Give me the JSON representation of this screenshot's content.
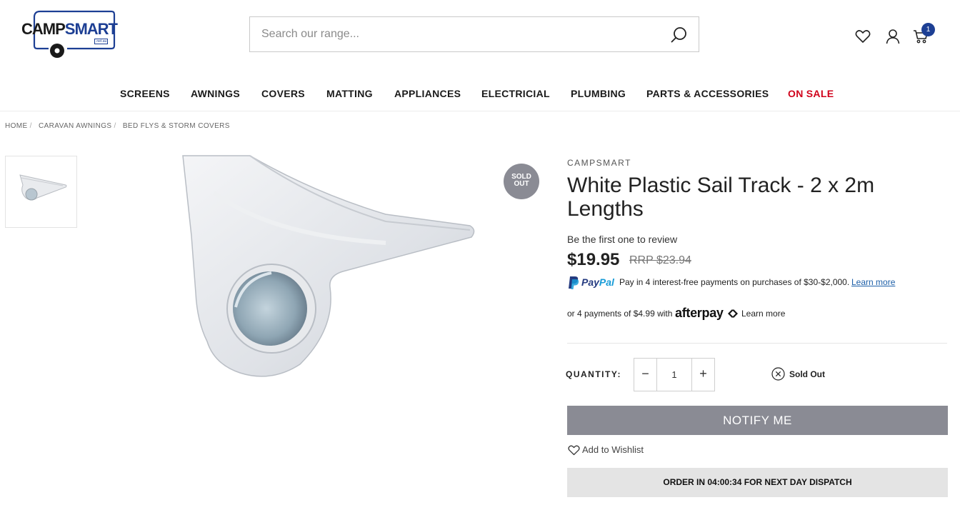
{
  "header": {
    "logo": {
      "text_camp": "CAMP",
      "text_smart": "SMART",
      "domain": ".net.au"
    },
    "search": {
      "placeholder": "Search our range...",
      "value": ""
    },
    "icons": [
      "search-icon",
      "heart-icon",
      "user-icon",
      "cart-icon"
    ],
    "cart_count": "1"
  },
  "nav": {
    "items": [
      {
        "label": "SCREENS"
      },
      {
        "label": "AWNINGS"
      },
      {
        "label": "COVERS"
      },
      {
        "label": "MATTING"
      },
      {
        "label": "APPLIANCES"
      },
      {
        "label": "ELECTRICIAL"
      },
      {
        "label": "PLUMBING"
      },
      {
        "label": "PARTS & ACCESSORIES"
      },
      {
        "label": "ON SALE"
      }
    ]
  },
  "breadcrumb": [
    "HOME",
    "CARAVAN AWNINGS",
    "BED FLYS & STORM COVERS"
  ],
  "gallery": {
    "sold_badge_line1": "SOLD",
    "sold_badge_line2": "OUT"
  },
  "product": {
    "brand": "CAMPSMART",
    "title": "White Plastic Sail Track - 2 x 2m Lengths",
    "review_text": "Be the first one to review",
    "price": "$19.95",
    "rrp": "RRP $23.94",
    "paypal": {
      "word_pay": "Pay",
      "word_pal": "Pal",
      "text": "Pay in 4 interest-free payments on purchases of $30-$2,000.",
      "link": "Learn more"
    },
    "afterpay": {
      "text": "or 4 payments of $4.99 with",
      "logo": "afterpay",
      "link": "Learn more"
    },
    "quantity": {
      "label": "QUANTITY:",
      "value": "1",
      "minus": "−",
      "plus": "+"
    },
    "stock_status": "Sold Out",
    "notify_button": "NOTIFY ME",
    "wishlist": "Add to Wishlist",
    "dispatch": "ORDER IN 04:00:34 FOR NEXT DAY DISPATCH"
  },
  "colors": {
    "brand_blue": "#1d3f94",
    "sale_red": "#d0021b",
    "button_grey": "#8a8b94",
    "dispatch_bg": "#e4e4e4"
  }
}
